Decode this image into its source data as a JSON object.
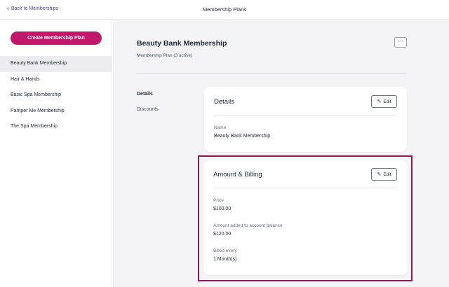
{
  "topbar": {
    "back_label": "Back to Memberships",
    "page_title": "Membership Plans"
  },
  "sidebar": {
    "create_label": "Create Membership Plan",
    "items": [
      {
        "label": "Beauty Bank Membership",
        "active": true
      },
      {
        "label": "Hair & Hands"
      },
      {
        "label": "Basic Spa Membership"
      },
      {
        "label": "Pamper Me Membership"
      },
      {
        "label": "The Spa Membership"
      }
    ]
  },
  "main": {
    "title": "Beauty Bank Membership",
    "subtitle": "Membership Plan (3 active)",
    "more_label": "···",
    "tabs": [
      {
        "label": "Details",
        "active": true
      },
      {
        "label": "Discounts"
      }
    ],
    "details_card": {
      "title": "Details",
      "edit_label": "Edit",
      "fields": [
        {
          "label": "Name",
          "value": "Beauty Bank Membership"
        }
      ]
    },
    "billing_card": {
      "title": "Amount & Billing",
      "edit_label": "Edit",
      "fields": [
        {
          "label": "Price",
          "value": "$100.00"
        },
        {
          "label": "Amount added to account balance",
          "value": "$120.00"
        },
        {
          "label": "Billed every",
          "value": "1 Month(s)"
        }
      ]
    }
  },
  "colors": {
    "brand": "#c2186b",
    "highlight": "#8e1a55",
    "nav_active_bg": "#ededf0"
  },
  "icons": {
    "back": "chevron-left-icon",
    "more": "ellipsis-icon",
    "edit": "pencil-icon"
  }
}
